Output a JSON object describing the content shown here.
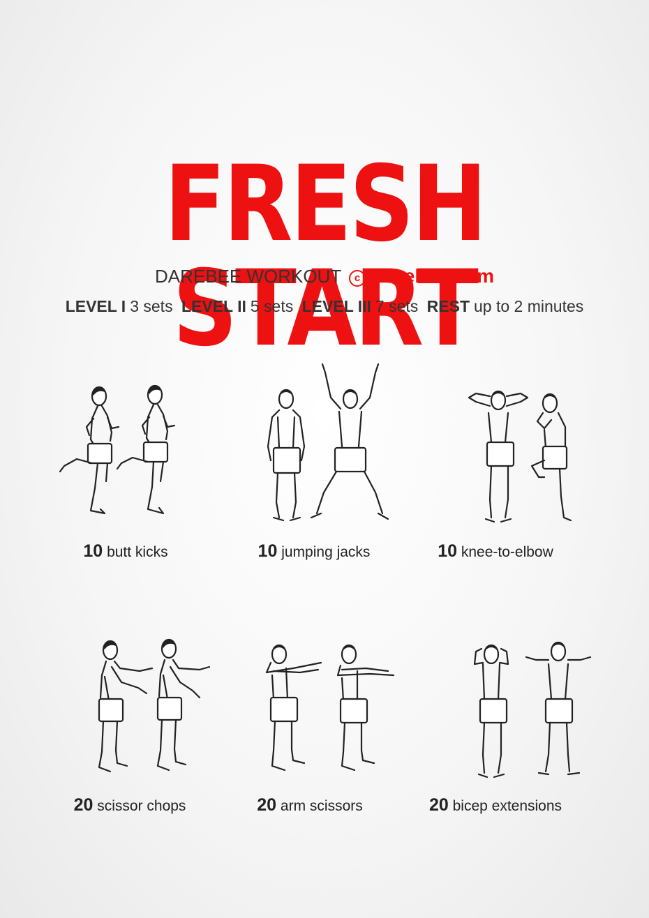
{
  "title": "FRESH START",
  "subtitle": {
    "prefix": "DAREBEE WORKOUT",
    "copyright_symbol": "c",
    "site": "darebee.com"
  },
  "levels": [
    {
      "label": "LEVEL I",
      "value": "3 sets"
    },
    {
      "label": "LEVEL II",
      "value": "5 sets"
    },
    {
      "label": "LEVEL III",
      "value": "7 sets"
    },
    {
      "label": "REST",
      "value": "up to 2 minutes"
    }
  ],
  "exercises": [
    {
      "count": "10",
      "name": "butt kicks",
      "icon": "butt-kicks-figure-icon"
    },
    {
      "count": "10",
      "name": "jumping jacks",
      "icon": "jumping-jacks-figure-icon"
    },
    {
      "count": "10",
      "name": "knee-to-elbow",
      "icon": "knee-to-elbow-figure-icon"
    },
    {
      "count": "20",
      "name": "scissor chops",
      "icon": "scissor-chops-figure-icon"
    },
    {
      "count": "20",
      "name": "arm scissors",
      "icon": "arm-scissors-figure-icon"
    },
    {
      "count": "20",
      "name": "bicep extensions",
      "icon": "bicep-extensions-figure-icon"
    }
  ],
  "colors": {
    "accent": "#ee1111",
    "text": "#333333"
  }
}
